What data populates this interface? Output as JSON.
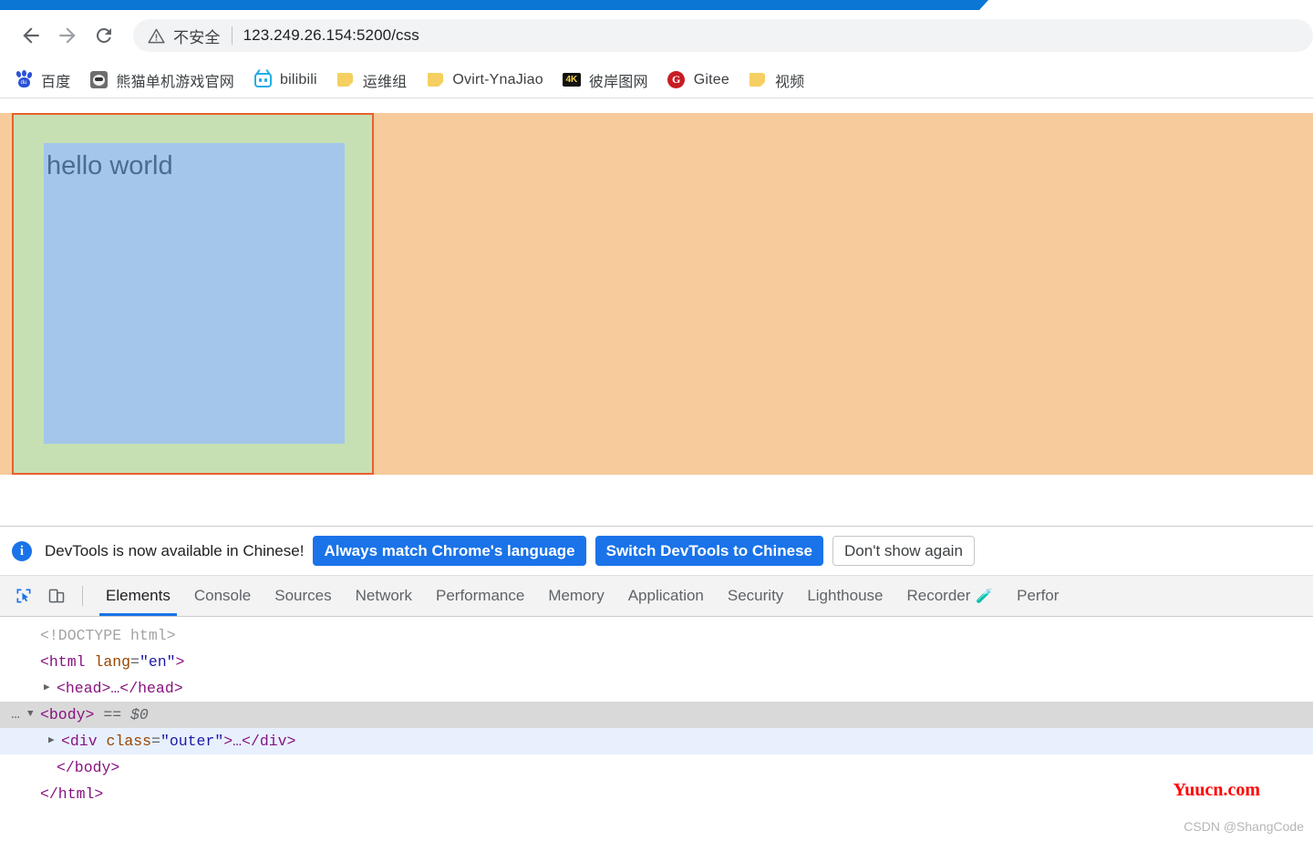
{
  "browser": {
    "nav": {
      "back_label": "Back",
      "forward_label": "Forward",
      "reload_label": "Reload"
    },
    "omnibox": {
      "security_warning": "不安全",
      "url": "123.249.26.154:5200/css",
      "warn_icon": "warning-triangle-icon"
    },
    "bookmarks": [
      {
        "label": "百度",
        "icon": "baidu-paw-icon"
      },
      {
        "label": "熊猫单机游戏官网",
        "icon": "panda-icon"
      },
      {
        "label": "bilibili",
        "icon": "bilibili-tv-icon"
      },
      {
        "label": "运维组",
        "icon": "folder-icon"
      },
      {
        "label": "Ovirt-YnaJiao",
        "icon": "folder-icon"
      },
      {
        "label": "彼岸图网",
        "icon": "4k-icon"
      },
      {
        "label": "Gitee",
        "icon": "gitee-icon"
      },
      {
        "label": "视频",
        "icon": "folder-icon"
      }
    ]
  },
  "page": {
    "outer_color": "#f7cb9b",
    "middle_color": "#c6e0b4",
    "middle_border_color": "#e8602c",
    "inner_color": "#a3c6ea",
    "inner_text": "hello world",
    "inner_text_color": "#4a6c91"
  },
  "devtools": {
    "banner": {
      "icon": "info-icon",
      "message": "DevTools is now available in Chinese!",
      "primary_button": "Always match Chrome's language",
      "secondary_button": "Switch DevTools to Chinese",
      "dismiss_button": "Don't show again"
    },
    "toolbar_icons": [
      {
        "name": "inspect-element-icon"
      },
      {
        "name": "device-toolbar-icon"
      }
    ],
    "tabs": [
      {
        "label": "Elements",
        "active": true
      },
      {
        "label": "Console",
        "active": false
      },
      {
        "label": "Sources",
        "active": false
      },
      {
        "label": "Network",
        "active": false
      },
      {
        "label": "Performance",
        "active": false
      },
      {
        "label": "Memory",
        "active": false
      },
      {
        "label": "Application",
        "active": false
      },
      {
        "label": "Security",
        "active": false
      },
      {
        "label": "Lighthouse",
        "active": false
      },
      {
        "label": "Recorder",
        "active": false,
        "badge": "beaker-icon"
      },
      {
        "label": "Perfor",
        "active": false
      }
    ],
    "tree": {
      "doctype": "<!DOCTYPE html>",
      "html_open_tag": "<html",
      "html_attr_name": "lang",
      "html_attr_value": "\"en\"",
      "html_open_close": ">",
      "head_line": "<head>…</head>",
      "body_open": "<body>",
      "body_selected_marker": "== $0",
      "div_open": "<div ",
      "div_attr_name": "class",
      "div_attr_value": "\"outer\"",
      "div_rest": ">…</div>",
      "body_close": "</body>",
      "html_close": "</html>",
      "dots": "…",
      "triangle_collapsed": "▶",
      "triangle_expanded": "▼"
    }
  },
  "watermarks": {
    "yuucn": "Yuucn.com",
    "csdn": "CSDN @ShangCode"
  }
}
